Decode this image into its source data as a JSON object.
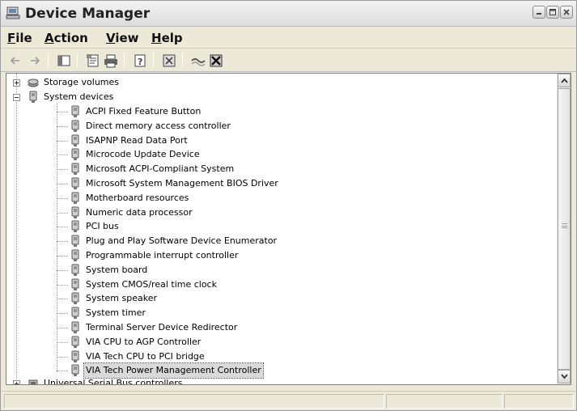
{
  "window": {
    "title": "Device Manager",
    "icon": "device-manager-icon"
  },
  "window_controls": [
    "minimize-icon",
    "maximize-icon",
    "close-icon"
  ],
  "menu": [
    {
      "label": "File",
      "underline": "F",
      "rest": "ile"
    },
    {
      "label": "Action",
      "underline": "A",
      "rest": "ction"
    },
    {
      "label": "View",
      "underline": "V",
      "rest": "iew"
    },
    {
      "label": "Help",
      "underline": "H",
      "rest": "elp"
    }
  ],
  "toolbar": {
    "icons": [
      "back-arrow-icon",
      "forward-arrow-icon",
      "show-hide-console-tree-icon",
      "properties-icon",
      "print-icon",
      "help-icon",
      "scan-hardware-icon",
      "update-driver-icon",
      "uninstall-icon"
    ]
  },
  "tree": {
    "storage": "Storage volumes",
    "system": "System devices",
    "children": [
      "ACPI Fixed Feature Button",
      "Direct memory access controller",
      "ISAPNP Read Data Port",
      "Microcode Update Device",
      "Microsoft ACPI-Compliant System",
      "Microsoft System Management BIOS Driver",
      "Motherboard resources",
      "Numeric data processor",
      "PCI bus",
      "Plug and Play Software Device Enumerator",
      "Programmable interrupt controller",
      "System board",
      "System CMOS/real time clock",
      "System speaker",
      "System timer",
      "Terminal Server Device Redirector",
      "VIA CPU to AGP Controller",
      "VIA Tech CPU to PCI bridge",
      "VIA Tech Power Management Controller"
    ],
    "selected": "VIA Tech Power Management Controller",
    "next": "Universal Serial Bus controllers"
  },
  "colors": {
    "selection": "#d9d9d9",
    "pane_bg": "#ffffff",
    "chrome": "#ece9d8"
  }
}
